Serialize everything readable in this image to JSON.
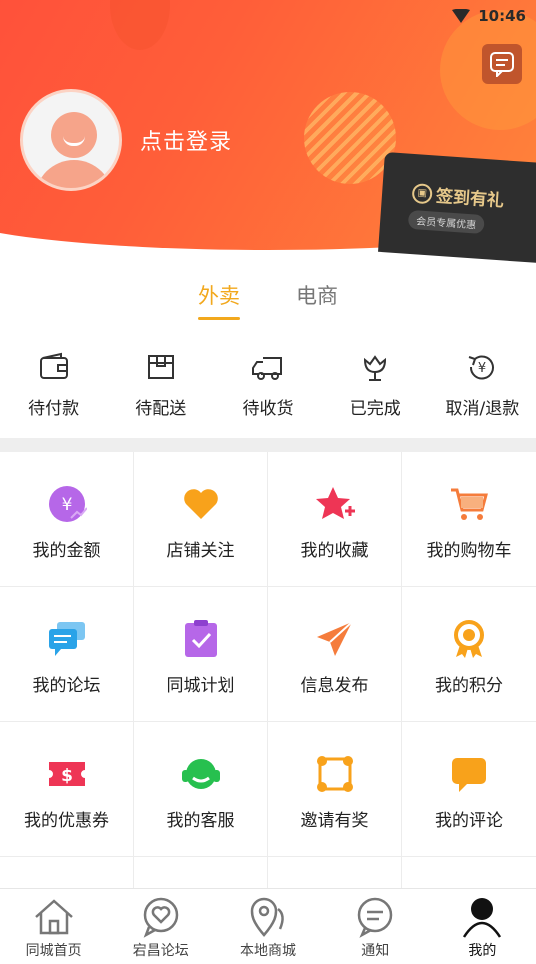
{
  "status_bar": {
    "time": "10:46"
  },
  "profile": {
    "login_text": "点击登录"
  },
  "signin_card": {
    "title": "签到有礼",
    "subtitle": "会员专属优惠"
  },
  "tabs": [
    {
      "label": "外卖",
      "active": true
    },
    {
      "label": "电商",
      "active": false
    }
  ],
  "orders": [
    {
      "label": "待付款",
      "icon": "wallet-icon"
    },
    {
      "label": "待配送",
      "icon": "package-icon"
    },
    {
      "label": "待收货",
      "icon": "truck-icon"
    },
    {
      "label": "已完成",
      "icon": "flower-icon"
    },
    {
      "label": "取消/退款",
      "icon": "refund-icon"
    }
  ],
  "grid": [
    {
      "label": "我的金额",
      "icon": "money-icon",
      "color": "#b667e8"
    },
    {
      "label": "店铺关注",
      "icon": "heart-icon",
      "color": "#f8a21b"
    },
    {
      "label": "我的收藏",
      "icon": "star-icon",
      "color": "#ee3555"
    },
    {
      "label": "我的购物车",
      "icon": "cart-icon",
      "color": "#f57c3b"
    },
    {
      "label": "我的论坛",
      "icon": "forum-icon",
      "color": "#2aa3e8"
    },
    {
      "label": "同城计划",
      "icon": "plan-icon",
      "color": "#b667e8"
    },
    {
      "label": "信息发布",
      "icon": "paper-plane-icon",
      "color": "#f57c3b"
    },
    {
      "label": "我的积分",
      "icon": "medal-icon",
      "color": "#f8a21b"
    },
    {
      "label": "我的优惠券",
      "icon": "coupon-icon",
      "color": "#ee3555"
    },
    {
      "label": "我的客服",
      "icon": "headset-icon",
      "color": "#27c04f"
    },
    {
      "label": "邀请有奖",
      "icon": "invite-icon",
      "color": "#f8a21b"
    },
    {
      "label": "我的评论",
      "icon": "comment-icon",
      "color": "#f8a21b"
    }
  ],
  "bottom_nav": [
    {
      "label": "同城首页",
      "icon": "home-icon",
      "active": false
    },
    {
      "label": "宕昌论坛",
      "icon": "forum-heart-icon",
      "active": false
    },
    {
      "label": "本地商城",
      "icon": "location-icon",
      "active": false
    },
    {
      "label": "通知",
      "icon": "notice-icon",
      "active": false
    },
    {
      "label": "我的",
      "icon": "user-icon",
      "active": true
    }
  ]
}
